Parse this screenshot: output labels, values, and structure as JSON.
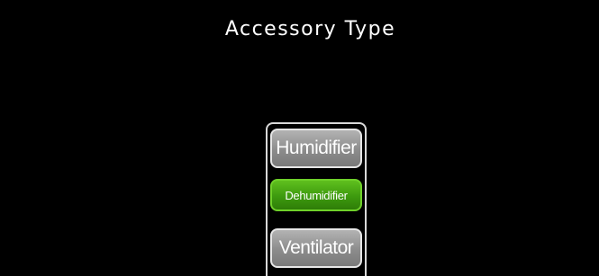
{
  "screen": {
    "title": "Accessory Type"
  },
  "options": [
    {
      "label": "Humidifier",
      "selected": false
    },
    {
      "label": "Dehumidifier",
      "selected": true
    },
    {
      "label": "Ventilator",
      "selected": false
    }
  ],
  "colors": {
    "background": "#000000",
    "title_text": "#ffffff",
    "option_grey": "#8c8c8c",
    "option_selected_green": "#3d9a0e",
    "option_border": "#e6e6e6"
  }
}
